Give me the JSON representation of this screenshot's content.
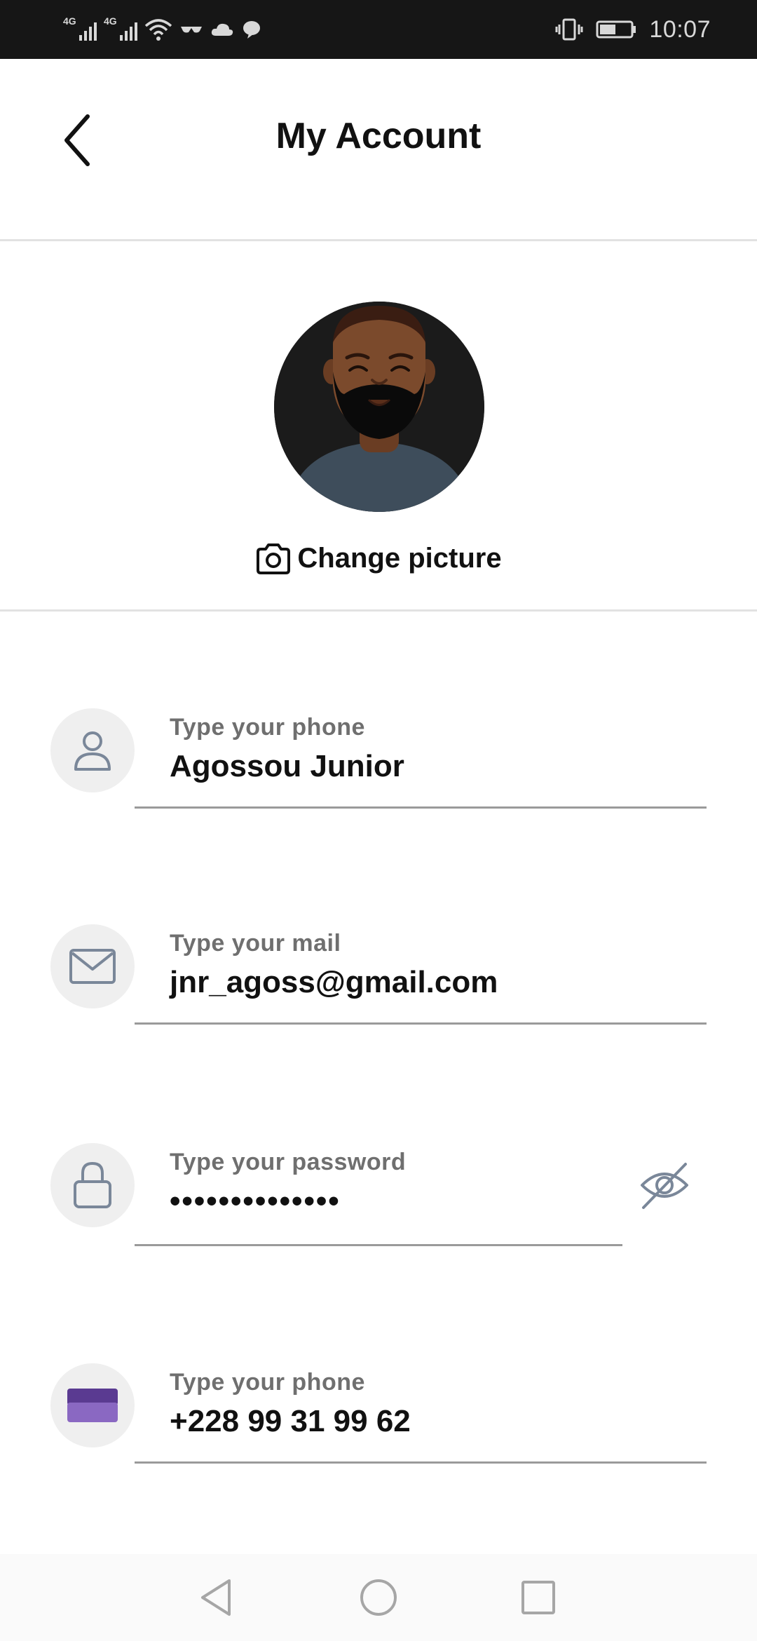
{
  "status_bar": {
    "network_1": "4G",
    "network_2": "4G",
    "time": "10:07",
    "icons": [
      "signal-icon",
      "signal-icon",
      "wifi-icon",
      "glasses-icon",
      "cloud-icon",
      "chat-bubble-icon",
      "vibrate-icon",
      "battery-icon"
    ]
  },
  "header": {
    "title": "My Account",
    "back_icon": "chevron-left-icon"
  },
  "profile": {
    "avatar_icon": "avatar-bearded-man",
    "change_picture_label": "Change picture",
    "camera_icon": "camera-icon"
  },
  "fields": [
    {
      "icon": "user-icon",
      "label": "Type your phone",
      "value": "Agossou Junior"
    },
    {
      "icon": "mail-icon",
      "label": "Type your mail",
      "value": "jnr_agoss@gmail.com"
    },
    {
      "icon": "lock-icon",
      "label": "Type your password",
      "value": "••••••••••••••",
      "toggle_icon": "eye-off-icon"
    },
    {
      "icon": "card-icon",
      "label": "Type your phone",
      "value": "+228 99 31 99 62"
    }
  ],
  "nav_bar": {
    "icons": [
      "back-triangle-icon",
      "home-circle-icon",
      "recents-square-icon"
    ]
  },
  "colors": {
    "status_bar_bg": "#161616",
    "divider": "#e2e2e2",
    "icon_circle_bg": "#efefef",
    "icon_stroke": "#7a8799",
    "label_grey": "#6f6f6f",
    "card_purple_dark": "#5a3a91",
    "card_purple_light": "#8a68c2"
  }
}
